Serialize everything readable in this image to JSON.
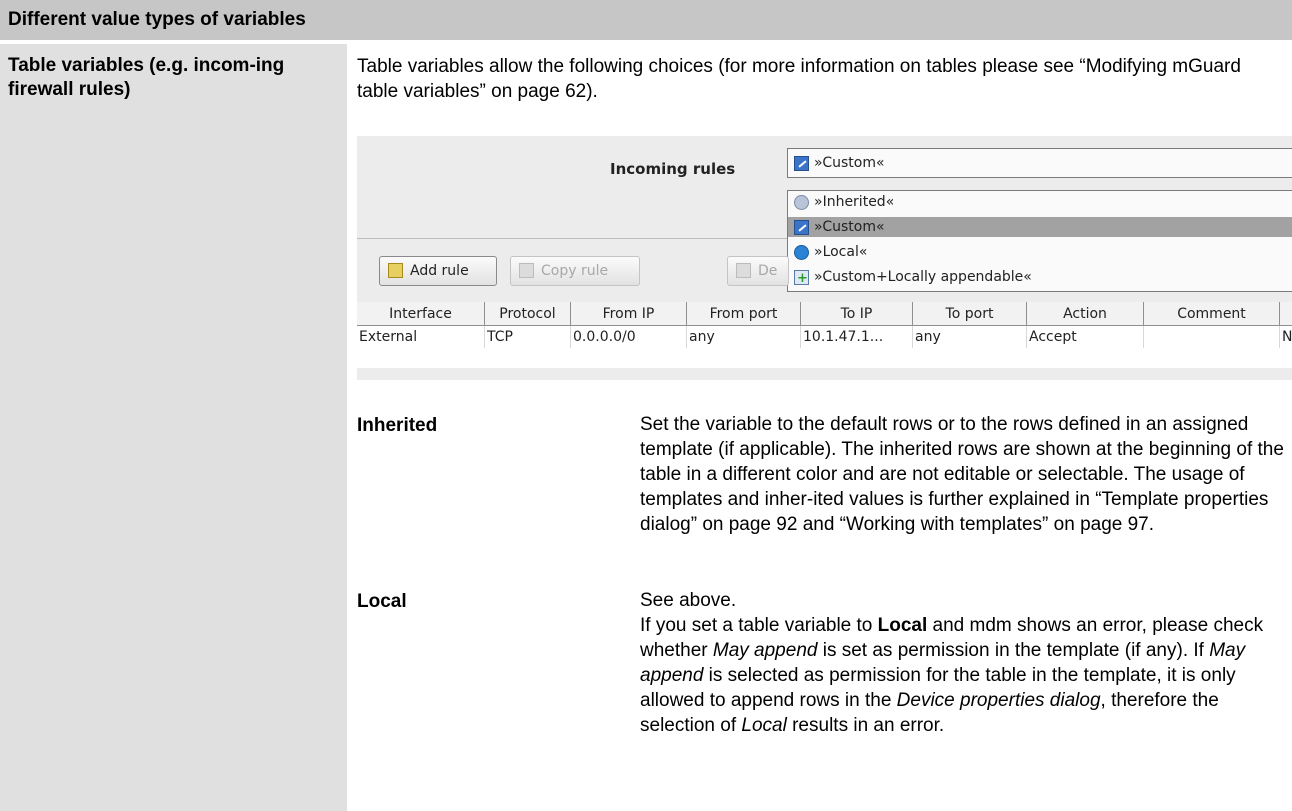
{
  "header": {
    "title": "Different value types of variables"
  },
  "left": {
    "label": "Table variables (e.g. incom-ing firewall rules)"
  },
  "intro": {
    "text": "Table variables allow the following choices (for more information on tables please see “Modifying mGuard table variables” on page 62)."
  },
  "screenshot": {
    "rules_label": "Incoming rules",
    "selected_value": "»Custom«",
    "dropdown_options": [
      {
        "label": "»Inherited«",
        "icon": "inherited-icon"
      },
      {
        "label": "»Custom«",
        "icon": "edit-icon"
      },
      {
        "label": "»Local«",
        "icon": "local-icon"
      },
      {
        "label": "»Custom+Locally appendable«",
        "icon": "append-icon"
      }
    ],
    "buttons": {
      "add_rule": "Add rule",
      "copy_rule": "Copy rule",
      "delete_rule": "De"
    },
    "table": {
      "columns": [
        "Interface",
        "Protocol",
        "From IP",
        "From port",
        "To IP",
        "To port",
        "Action",
        "Comment",
        ""
      ],
      "rows": [
        [
          "External",
          "TCP",
          "0.0.0.0/0",
          "any",
          "10.1.47.1...",
          "any",
          "Accept",
          "",
          "N"
        ]
      ]
    }
  },
  "definitions": {
    "inherited": {
      "term": "Inherited",
      "text": "Set the variable to the default rows or to the rows defined in an assigned template (if applicable). The inherited rows are shown at the beginning of the table in a different color and are not editable or selectable. The usage of templates and inher-ited values is further explained in “Template properties dialog” on page 92 and “Working with templates” on page 97."
    },
    "local": {
      "term": "Local",
      "line1": "See above.",
      "p1": "If you set a table variable to ",
      "b1": "Local",
      "p2": " and mdm shows an error, please check whether ",
      "i1": "May append",
      "p3": " is set as permission in the template (if any). If ",
      "i2": "May append",
      "p4": " is selected as permission for the table in the template, it is only allowed to append rows in the ",
      "i3": "Device properties dialog",
      "p5": ", therefore the selection of ",
      "i4": "Local",
      "p6": " results in an error."
    }
  }
}
